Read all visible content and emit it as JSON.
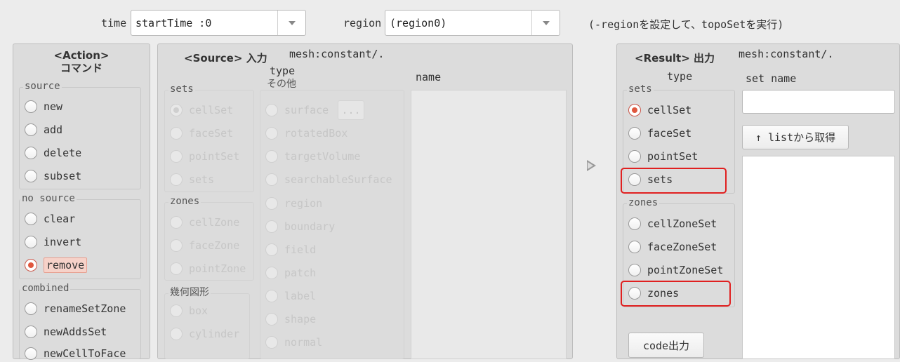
{
  "top": {
    "time_label": "time",
    "time_value": "startTime :0",
    "region_label": "region",
    "region_value": "(region0)",
    "hint": "(-regionを設定して、topoSetを実行)"
  },
  "action": {
    "title_line1": "<Action>",
    "title_line2": "コマンド",
    "source_group": "source",
    "source_items": [
      "new",
      "add",
      "delete",
      "subset"
    ],
    "nosource_group": "no source",
    "nosource_items": [
      "clear",
      "invert",
      "remove"
    ],
    "combined_group": "combined",
    "combined_items": [
      "renameSetZone",
      "newAddsSet",
      "newCellToFace"
    ]
  },
  "source": {
    "title": "<Source> 入力",
    "path": "mesh:constant/.",
    "type_label": "type",
    "name_label": "name",
    "sets_group": "sets",
    "sets_items": [
      "cellSet",
      "faceSet",
      "pointSet",
      "sets"
    ],
    "zones_group": "zones",
    "zones_items": [
      "cellZone",
      "faceZone",
      "pointZone"
    ],
    "geom_group": "幾何図形",
    "geom_items": [
      "box",
      "cylinder"
    ],
    "other_group": "その他",
    "other_items": [
      "surface",
      "rotatedBox",
      "targetVolume",
      "searchableSurface",
      "region",
      "boundary",
      "field",
      "patch",
      "label",
      "shape",
      "normal"
    ],
    "ellipsis": "..."
  },
  "result": {
    "title": "<Result> 出力",
    "path": "mesh:constant/.",
    "type_label": "type",
    "setname_label": "set name",
    "sets_group": "sets",
    "sets_items": [
      "cellSet",
      "faceSet",
      "pointSet",
      "sets"
    ],
    "zones_group": "zones",
    "zones_items": [
      "cellZoneSet",
      "faceZoneSet",
      "pointZoneSet",
      "zones"
    ],
    "list_button": "↑ listから取得",
    "code_button": "code出力",
    "setname_value": ""
  },
  "colors": {
    "highlight": "#e02020",
    "radio_checked": "#e0573e"
  }
}
